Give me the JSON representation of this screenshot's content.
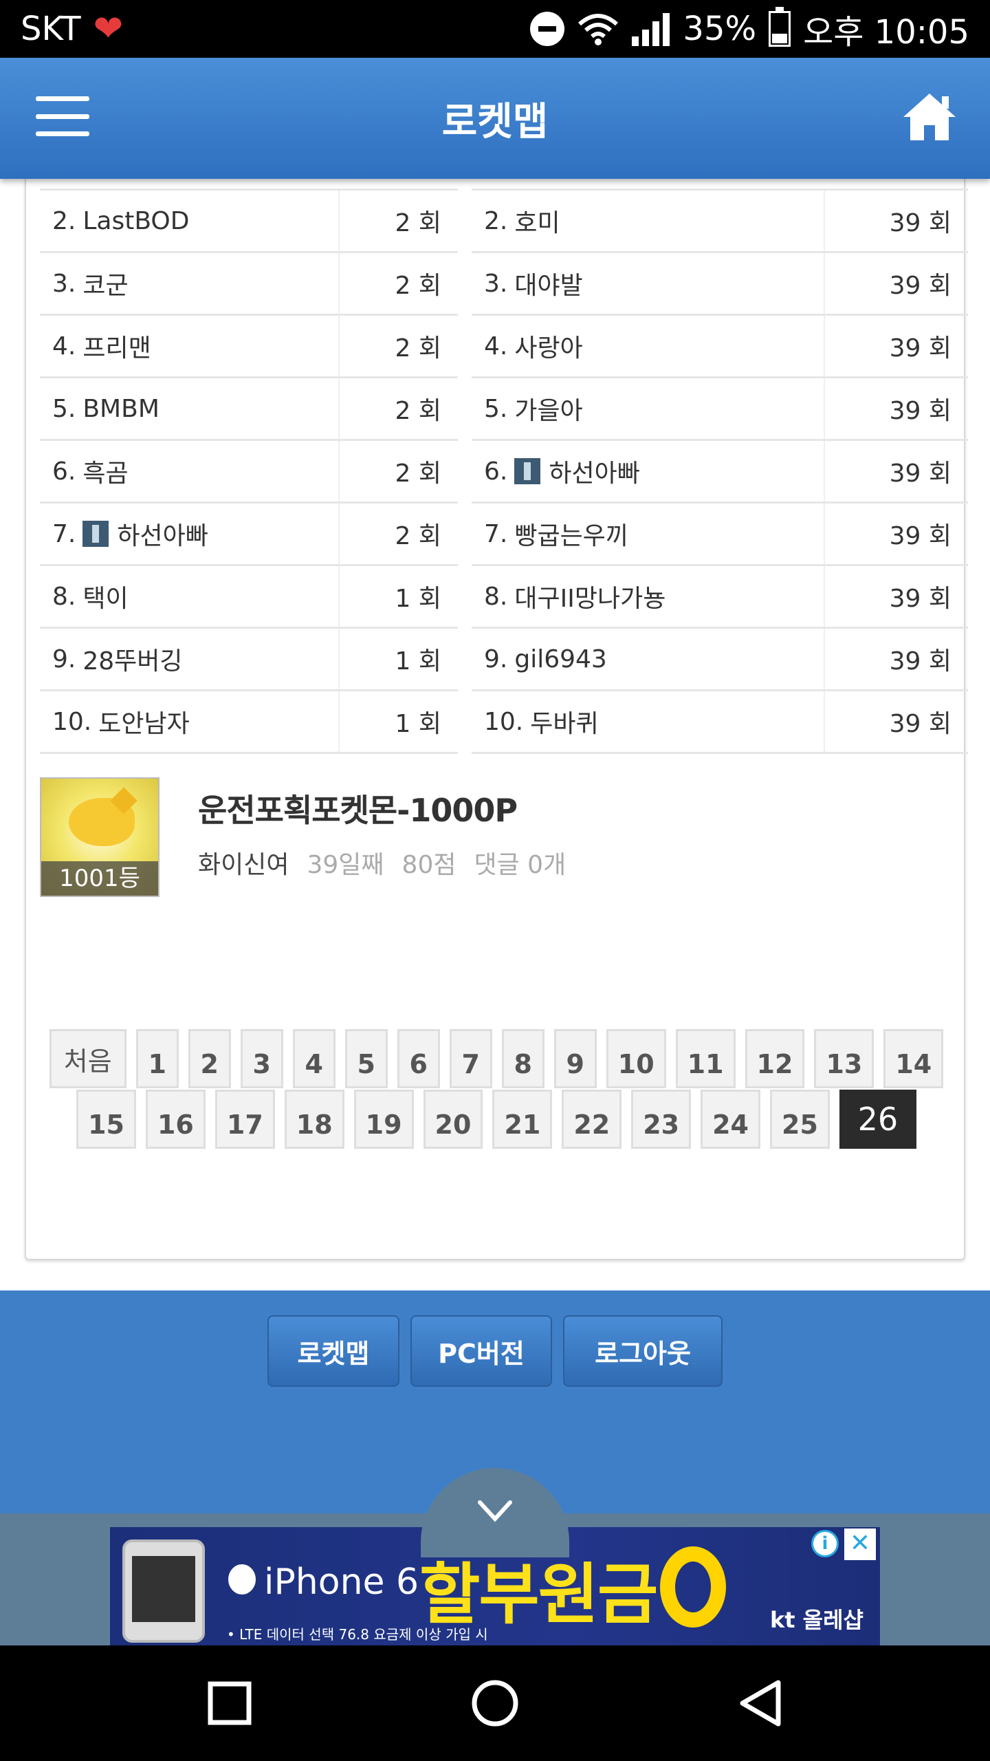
{
  "status_bar": {
    "carrier": "SKT",
    "battery": "35%",
    "time": "오후 10:05"
  },
  "header": {
    "title": "로켓맵"
  },
  "left_ranking": [
    {
      "rank": "2.",
      "name": "LastBOD",
      "count": "2 회",
      "has_avatar": false
    },
    {
      "rank": "3.",
      "name": "코군",
      "count": "2 회",
      "has_avatar": false
    },
    {
      "rank": "4.",
      "name": "프리맨",
      "count": "2 회",
      "has_avatar": false
    },
    {
      "rank": "5.",
      "name": "BMBM",
      "count": "2 회",
      "has_avatar": false
    },
    {
      "rank": "6.",
      "name": "흑곰",
      "count": "2 회",
      "has_avatar": false
    },
    {
      "rank": "7.",
      "name": "하선아빠",
      "count": "2 회",
      "has_avatar": true
    },
    {
      "rank": "8.",
      "name": "택이",
      "count": "1 회",
      "has_avatar": false
    },
    {
      "rank": "9.",
      "name": "28뚜버깅",
      "count": "1 회",
      "has_avatar": false
    },
    {
      "rank": "10.",
      "name": "도안남자",
      "count": "1 회",
      "has_avatar": false
    }
  ],
  "right_ranking": [
    {
      "rank": "2.",
      "name": "호미",
      "count": "39 회",
      "has_avatar": false
    },
    {
      "rank": "3.",
      "name": "대야발",
      "count": "39 회",
      "has_avatar": false
    },
    {
      "rank": "4.",
      "name": "사랑아",
      "count": "39 회",
      "has_avatar": false
    },
    {
      "rank": "5.",
      "name": "가을아",
      "count": "39 회",
      "has_avatar": false
    },
    {
      "rank": "6.",
      "name": "하선아빠",
      "count": "39 회",
      "has_avatar": true
    },
    {
      "rank": "7.",
      "name": "빵굽는우끼",
      "count": "39 회",
      "has_avatar": false
    },
    {
      "rank": "8.",
      "name": "대구II망나가뇽",
      "count": "39 회",
      "has_avatar": false
    },
    {
      "rank": "9.",
      "name": "gil6943",
      "count": "39 회",
      "has_avatar": false
    },
    {
      "rank": "10.",
      "name": "두바퀴",
      "count": "39 회",
      "has_avatar": false
    }
  ],
  "post": {
    "thumb_rank": "1001등",
    "title": "운전포획포켓몬-1000P",
    "author": "화이신여",
    "days": "39일째",
    "points": "80점",
    "comments": "댓글 0개"
  },
  "pagination": {
    "first_label": "처음",
    "row1": [
      "1",
      "2",
      "3",
      "4",
      "5",
      "6",
      "7",
      "8",
      "9",
      "10",
      "11",
      "12",
      "13",
      "14"
    ],
    "row2": [
      "15",
      "16",
      "17",
      "18",
      "19",
      "20",
      "21",
      "22",
      "23",
      "24",
      "25"
    ],
    "active": "26"
  },
  "footer": {
    "buttons": [
      "로켓맵",
      "PC버전",
      "로그아웃"
    ]
  },
  "ad": {
    "product": "iPhone 6",
    "headline": "할부원금",
    "fine_print": "• LTE 데이터 선택 76.8 요금제 이상 가입 시",
    "brand": "kt 올레샵",
    "info_label": "i",
    "close_label": "✕"
  },
  "colors": {
    "header_blue": "#3f7fc8",
    "active_page": "#2b2b2b",
    "ad_yellow": "#ffe11a"
  }
}
